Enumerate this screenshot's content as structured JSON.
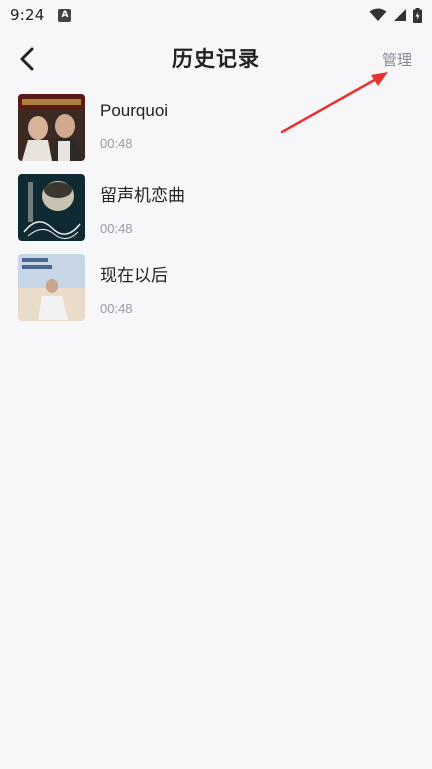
{
  "status_bar": {
    "time": "9:24",
    "notification_letter": "A",
    "icons": [
      "wifi-icon",
      "signal-icon",
      "battery-icon"
    ]
  },
  "header": {
    "back_icon": "chevron-left-icon",
    "title": "历史记录",
    "manage_label": "管理"
  },
  "history": [
    {
      "title": "Pourquoi",
      "duration": "00:48"
    },
    {
      "title": "留声机恋曲",
      "duration": "00:48"
    },
    {
      "title": "现在以后",
      "duration": "00:48"
    }
  ],
  "colors": {
    "background": "#f7f7f9",
    "title_text": "#222222",
    "secondary_text": "#9a9aa6",
    "annotation_arrow": "#e8322e"
  }
}
